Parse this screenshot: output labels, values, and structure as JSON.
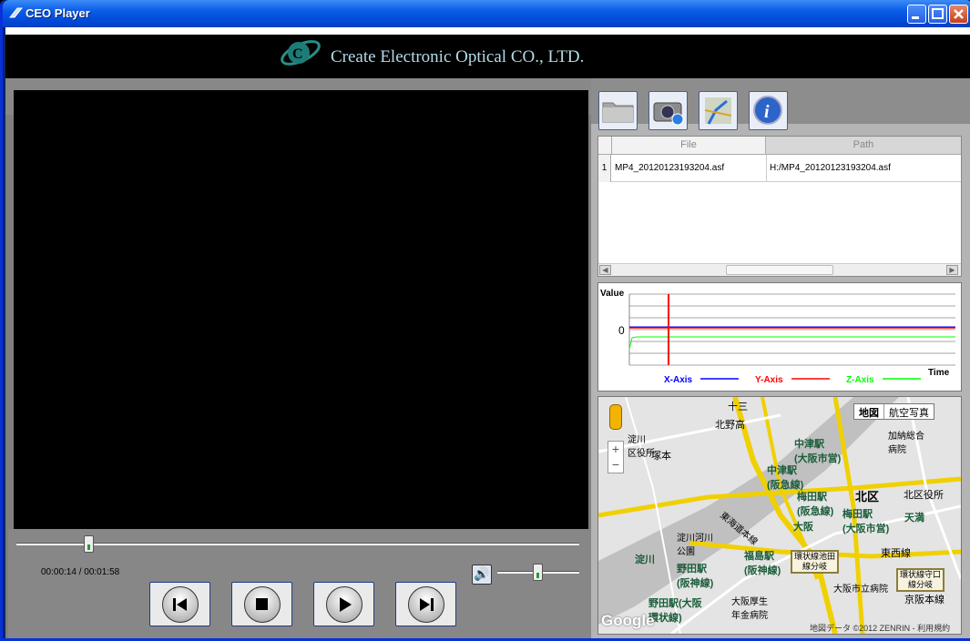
{
  "window": {
    "title": "CEO Player"
  },
  "banner": {
    "company": "Create Electronic Optical CO., LTD."
  },
  "player": {
    "time": "00:00:14 / 00:01:58",
    "progress": 0.12,
    "volume": 0.5,
    "controls": [
      "previous",
      "stop",
      "play",
      "next"
    ]
  },
  "toolbar": {
    "icons": [
      "folder-icon",
      "camera-icon",
      "map-icon",
      "info-icon"
    ]
  },
  "file_table": {
    "columns": [
      "File",
      "Path"
    ],
    "rows": [
      {
        "num": "1",
        "file": "MP4_20120123193204.asf",
        "path": "H:/MP4_20120123193204.asf"
      }
    ]
  },
  "chart_data": {
    "type": "line",
    "ylabel": "Value",
    "xlabel": "Time",
    "yticks": [
      "0"
    ],
    "legend": [
      {
        "name": "X-Axis",
        "color": "#0000ff"
      },
      {
        "name": "Y-Axis",
        "color": "#ff0000"
      },
      {
        "name": "Z-Axis",
        "color": "#00ff00"
      }
    ],
    "cursor_color": "#ff0000"
  },
  "map": {
    "toggle": [
      "地図",
      "航空写真"
    ],
    "labels": {
      "juso": "十三",
      "tsukamoto": "塚本",
      "kitanohon": "北野高",
      "nakatsu_hankyu": "中津駅\n(阪急線)",
      "nakatsu_osaka": "中津駅\n(大阪市営)",
      "umeda_hankyu": "梅田駅\n(阪急線)",
      "umeda_osaka": "梅田駅\n(大阪市営)",
      "kitaku": "北区",
      "osaka": "大阪",
      "tenma": "天満",
      "fukushima": "福島駅\n(阪神線)",
      "noda_hanshin": "野田駅\n(阪神線)",
      "noda_osaka": "野田駅(大阪\n環状線)",
      "yodogawa": "淀川",
      "kitakuyakusho": "北区役所",
      "higashi_line": "東西線",
      "kyobashi_line": "京阪本線",
      "kanjo_ikeda": "環状線池田\n線分岐",
      "kanjo_moriguchi": "環状線守口\n線分岐",
      "yodogawa_park": "淀川河川\n公園",
      "shinkansen": "東海道本線",
      "nakatsu_ward_office": "淀川\n区役所",
      "kanobyoin": "加納総合\n病院",
      "osaka_city_hospital": "大阪市立病院",
      "kaijin": "大阪厚生\n年金病院"
    },
    "copyright": "地図データ ©2012 ZENRIN - 利用規約",
    "google": "Google"
  }
}
